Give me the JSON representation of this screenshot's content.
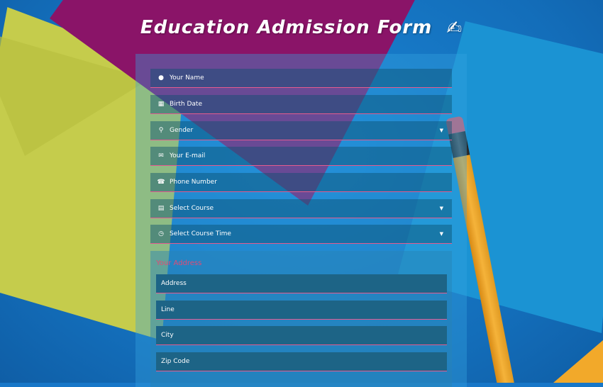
{
  "title": "Education Admission Form",
  "title_icon": "hand-writing-icon",
  "fields": [
    {
      "placeholder": "Your Name",
      "icon": "user-icon"
    },
    {
      "placeholder": "Birth Date",
      "icon": "calendar-icon"
    },
    {
      "placeholder": "Gender",
      "icon": "location-pin-icon",
      "type": "select"
    },
    {
      "placeholder": "Your E-mail",
      "icon": "envelope-icon"
    },
    {
      "placeholder": "Phone Number",
      "icon": "phone-icon"
    },
    {
      "placeholder": "Select Course",
      "icon": "book-icon",
      "type": "select"
    },
    {
      "placeholder": "Select Course Time",
      "icon": "clock-icon",
      "type": "select"
    }
  ],
  "address": {
    "legend": "Your Address",
    "fields": [
      "Address",
      "Line",
      "City",
      "Zip Code"
    ]
  },
  "colors": {
    "accent": "#e55a8f",
    "legend": "#e04b76",
    "background": "#1877c8"
  }
}
